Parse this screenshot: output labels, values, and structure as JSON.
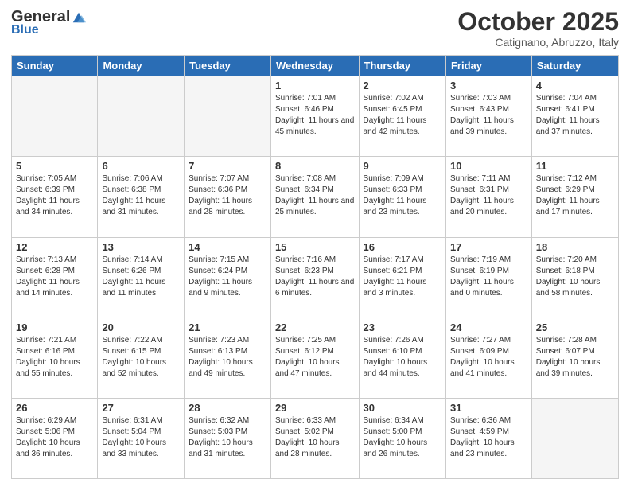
{
  "header": {
    "logo_general": "General",
    "logo_blue": "Blue",
    "month_title": "October 2025",
    "location": "Catignano, Abruzzo, Italy"
  },
  "days_of_week": [
    "Sunday",
    "Monday",
    "Tuesday",
    "Wednesday",
    "Thursday",
    "Friday",
    "Saturday"
  ],
  "weeks": [
    [
      {
        "day": "",
        "info": ""
      },
      {
        "day": "",
        "info": ""
      },
      {
        "day": "",
        "info": ""
      },
      {
        "day": "1",
        "info": "Sunrise: 7:01 AM\nSunset: 6:46 PM\nDaylight: 11 hours and 45 minutes."
      },
      {
        "day": "2",
        "info": "Sunrise: 7:02 AM\nSunset: 6:45 PM\nDaylight: 11 hours and 42 minutes."
      },
      {
        "day": "3",
        "info": "Sunrise: 7:03 AM\nSunset: 6:43 PM\nDaylight: 11 hours and 39 minutes."
      },
      {
        "day": "4",
        "info": "Sunrise: 7:04 AM\nSunset: 6:41 PM\nDaylight: 11 hours and 37 minutes."
      }
    ],
    [
      {
        "day": "5",
        "info": "Sunrise: 7:05 AM\nSunset: 6:39 PM\nDaylight: 11 hours and 34 minutes."
      },
      {
        "day": "6",
        "info": "Sunrise: 7:06 AM\nSunset: 6:38 PM\nDaylight: 11 hours and 31 minutes."
      },
      {
        "day": "7",
        "info": "Sunrise: 7:07 AM\nSunset: 6:36 PM\nDaylight: 11 hours and 28 minutes."
      },
      {
        "day": "8",
        "info": "Sunrise: 7:08 AM\nSunset: 6:34 PM\nDaylight: 11 hours and 25 minutes."
      },
      {
        "day": "9",
        "info": "Sunrise: 7:09 AM\nSunset: 6:33 PM\nDaylight: 11 hours and 23 minutes."
      },
      {
        "day": "10",
        "info": "Sunrise: 7:11 AM\nSunset: 6:31 PM\nDaylight: 11 hours and 20 minutes."
      },
      {
        "day": "11",
        "info": "Sunrise: 7:12 AM\nSunset: 6:29 PM\nDaylight: 11 hours and 17 minutes."
      }
    ],
    [
      {
        "day": "12",
        "info": "Sunrise: 7:13 AM\nSunset: 6:28 PM\nDaylight: 11 hours and 14 minutes."
      },
      {
        "day": "13",
        "info": "Sunrise: 7:14 AM\nSunset: 6:26 PM\nDaylight: 11 hours and 11 minutes."
      },
      {
        "day": "14",
        "info": "Sunrise: 7:15 AM\nSunset: 6:24 PM\nDaylight: 11 hours and 9 minutes."
      },
      {
        "day": "15",
        "info": "Sunrise: 7:16 AM\nSunset: 6:23 PM\nDaylight: 11 hours and 6 minutes."
      },
      {
        "day": "16",
        "info": "Sunrise: 7:17 AM\nSunset: 6:21 PM\nDaylight: 11 hours and 3 minutes."
      },
      {
        "day": "17",
        "info": "Sunrise: 7:19 AM\nSunset: 6:19 PM\nDaylight: 11 hours and 0 minutes."
      },
      {
        "day": "18",
        "info": "Sunrise: 7:20 AM\nSunset: 6:18 PM\nDaylight: 10 hours and 58 minutes."
      }
    ],
    [
      {
        "day": "19",
        "info": "Sunrise: 7:21 AM\nSunset: 6:16 PM\nDaylight: 10 hours and 55 minutes."
      },
      {
        "day": "20",
        "info": "Sunrise: 7:22 AM\nSunset: 6:15 PM\nDaylight: 10 hours and 52 minutes."
      },
      {
        "day": "21",
        "info": "Sunrise: 7:23 AM\nSunset: 6:13 PM\nDaylight: 10 hours and 49 minutes."
      },
      {
        "day": "22",
        "info": "Sunrise: 7:25 AM\nSunset: 6:12 PM\nDaylight: 10 hours and 47 minutes."
      },
      {
        "day": "23",
        "info": "Sunrise: 7:26 AM\nSunset: 6:10 PM\nDaylight: 10 hours and 44 minutes."
      },
      {
        "day": "24",
        "info": "Sunrise: 7:27 AM\nSunset: 6:09 PM\nDaylight: 10 hours and 41 minutes."
      },
      {
        "day": "25",
        "info": "Sunrise: 7:28 AM\nSunset: 6:07 PM\nDaylight: 10 hours and 39 minutes."
      }
    ],
    [
      {
        "day": "26",
        "info": "Sunrise: 6:29 AM\nSunset: 5:06 PM\nDaylight: 10 hours and 36 minutes."
      },
      {
        "day": "27",
        "info": "Sunrise: 6:31 AM\nSunset: 5:04 PM\nDaylight: 10 hours and 33 minutes."
      },
      {
        "day": "28",
        "info": "Sunrise: 6:32 AM\nSunset: 5:03 PM\nDaylight: 10 hours and 31 minutes."
      },
      {
        "day": "29",
        "info": "Sunrise: 6:33 AM\nSunset: 5:02 PM\nDaylight: 10 hours and 28 minutes."
      },
      {
        "day": "30",
        "info": "Sunrise: 6:34 AM\nSunset: 5:00 PM\nDaylight: 10 hours and 26 minutes."
      },
      {
        "day": "31",
        "info": "Sunrise: 6:36 AM\nSunset: 4:59 PM\nDaylight: 10 hours and 23 minutes."
      },
      {
        "day": "",
        "info": ""
      }
    ]
  ]
}
